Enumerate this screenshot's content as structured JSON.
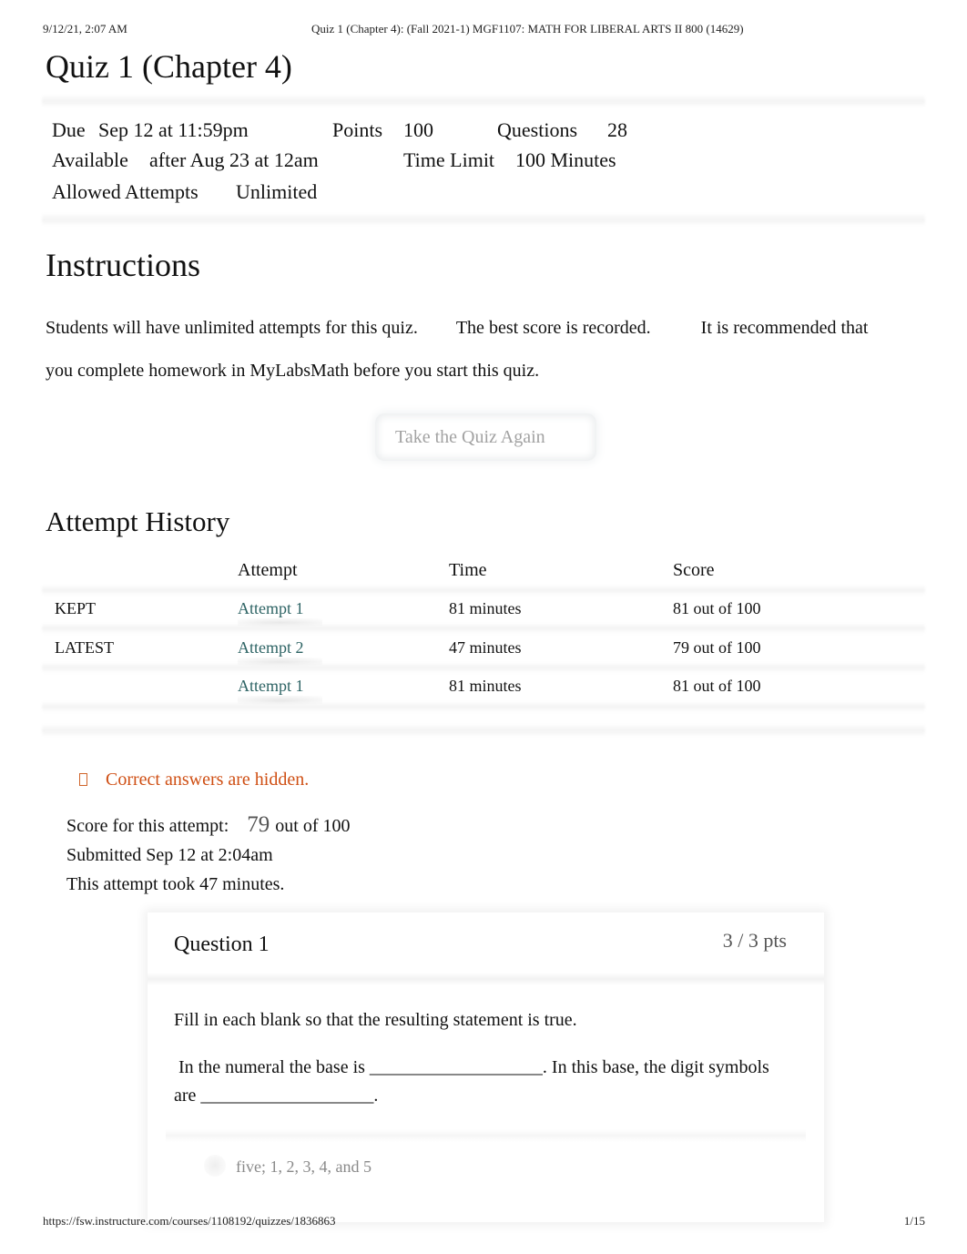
{
  "print_header": {
    "date": "9/12/21, 2:07 AM",
    "doc_title": "Quiz 1 (Chapter 4): (Fall 2021-1) MGF1107: MATH FOR LIBERAL ARTS II 800 (14629)"
  },
  "print_footer": {
    "url": "https://fsw.instructure.com/courses/1108192/quizzes/1836863",
    "page": "1/15"
  },
  "quiz": {
    "title": "Quiz 1 (Chapter 4)",
    "details": {
      "due_label": "Due",
      "due_value": "Sep 12 at 11:59pm",
      "points_label": "Points",
      "points_value": "100",
      "questions_label": "Questions",
      "questions_value": "28",
      "available_label": "Available",
      "available_value": "after Aug 23 at 12am",
      "time_limit_label": "Time Limit",
      "time_limit_value": "100 Minutes",
      "allowed_attempts_label": "Allowed Attempts",
      "allowed_attempts_value": "Unlimited"
    }
  },
  "instructions": {
    "title": "Instructions",
    "sentence1": "Students will have unlimited attempts for this quiz.",
    "sentence2": "The best score is recorded.",
    "sentence3": "It is recommended that",
    "sentence3_cont": "you complete homework in MyLabsMath before you start this quiz."
  },
  "take_quiz_again_label": "Take the Quiz Again",
  "attempt_history": {
    "title": "Attempt History",
    "columns": [
      "",
      "Attempt",
      "Time",
      "Score"
    ],
    "rows": [
      {
        "tag": "KEPT",
        "attempt": "Attempt 1",
        "time": "81 minutes",
        "score": "81 out of 100"
      },
      {
        "tag": "LATEST",
        "attempt": "Attempt 2",
        "time": "47 minutes",
        "score": "79 out of 100"
      },
      {
        "tag": "",
        "attempt": "Attempt 1",
        "time": "81 minutes",
        "score": "81 out of 100"
      }
    ]
  },
  "notice": {
    "icon": "warning-icon",
    "text": "Correct answers are hidden.",
    "color": "#cf4f14"
  },
  "attempt_summary": {
    "score_label": "Score for this attempt:",
    "score_value": "79",
    "score_suffix": "out of 100",
    "submitted": "Submitted Sep 12 at 2:04am",
    "duration": "This attempt took 47 minutes."
  },
  "questions": [
    {
      "title": "Question 1",
      "points": "3 / 3 pts",
      "prompt": "Fill in each blank so that the resulting statement is true.",
      "statement": " In the numeral the base is ___________________. In this base, the digit symbols are ___________________.",
      "answer": "five; 1, 2, 3, 4, and 5"
    }
  ],
  "colors": {
    "link": "#2d6364",
    "muted": "#8a8a8a",
    "button_text": "#a2a2a2"
  }
}
